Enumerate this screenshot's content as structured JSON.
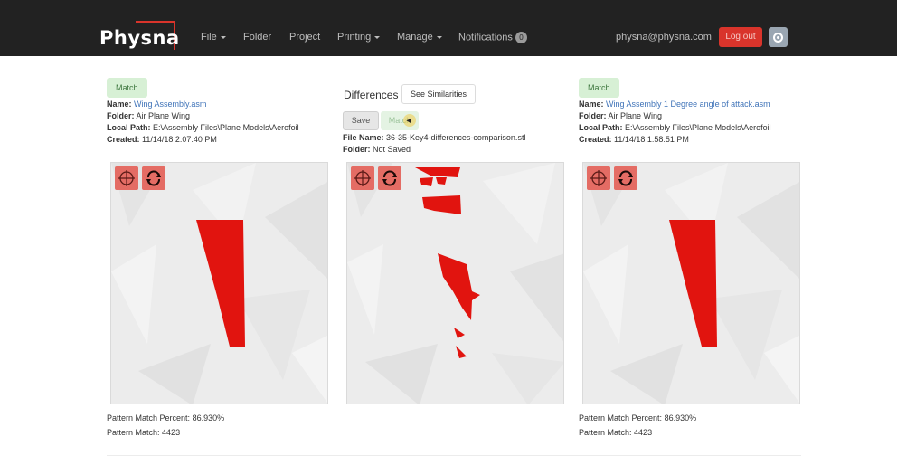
{
  "nav": {
    "brand": "Physna",
    "items": [
      {
        "label": "File",
        "dropdown": true
      },
      {
        "label": "Folder",
        "dropdown": false
      },
      {
        "label": "Project",
        "dropdown": false
      },
      {
        "label": "Printing",
        "dropdown": true
      },
      {
        "label": "Manage",
        "dropdown": true
      },
      {
        "label": "Notifications",
        "dropdown": false
      }
    ],
    "notification_count": "0",
    "user_email": "physna@physna.com",
    "logout_label": "Log out",
    "settings_icon": "gear-icon"
  },
  "left": {
    "match_label": "Match",
    "name_label": "Name:",
    "name": "Wing Assembly.asm",
    "folder_label": "Folder:",
    "folder": "Air Plane Wing",
    "path_label": "Local Path:",
    "path": "E:\\Assembly Files\\Plane Models\\Aerofoil",
    "created_label": "Created:",
    "created": "11/14/18 2:07:40 PM",
    "pattern_percent_label": "Pattern Match Percent:",
    "pattern_percent": "86.930%",
    "pattern_match_label": "Pattern Match:",
    "pattern_match": "4423"
  },
  "middle": {
    "title": "Differences",
    "see_similarities_label": "See Similarities",
    "save_label": "Save",
    "match_label": "Match",
    "file_name_label": "File Name:",
    "file_name": "36-35-Key4-differences-comparison.stl",
    "folder_label": "Folder:",
    "folder": "Not Saved"
  },
  "right": {
    "match_label": "Match",
    "name_label": "Name:",
    "name": "Wing Assembly 1 Degree angle of attack.asm",
    "folder_label": "Folder:",
    "folder": "Air Plane Wing",
    "path_label": "Local Path:",
    "path": "E:\\Assembly Files\\Plane Models\\Aerofoil",
    "created_label": "Created:",
    "created": "11/14/18 1:58:51 PM",
    "pattern_percent_label": "Pattern Match Percent:",
    "pattern_percent": "86.930%",
    "pattern_match_label": "Pattern Match:",
    "pattern_match": "4423"
  },
  "viewer_tools": [
    "orbit-icon",
    "rotate-icon"
  ],
  "colors": {
    "navbar": "#222222",
    "accent_red": "#d9342b",
    "model_red": "#e1140f",
    "match_green_bg": "#d7f0d5",
    "link_blue": "#3f73b8"
  }
}
